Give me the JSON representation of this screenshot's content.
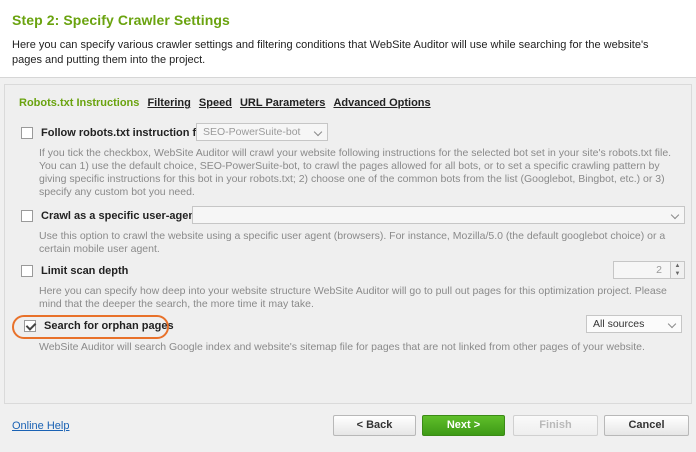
{
  "header": {
    "title": "Step 2: Specify Crawler Settings",
    "description": "Here you can specify various crawler settings and filtering conditions that WebSite Auditor will use while searching for the website's pages and putting them into the project."
  },
  "tabs": [
    {
      "label": "Robots.txt Instructions",
      "active": true
    },
    {
      "label": "Filtering",
      "active": false
    },
    {
      "label": "Speed",
      "active": false
    },
    {
      "label": "URL Parameters",
      "active": false
    },
    {
      "label": "Advanced Options",
      "active": false
    }
  ],
  "options": {
    "robots": {
      "label": "Follow robots.txt instruction for",
      "checked": false,
      "select_value": "SEO-PowerSuite-bot",
      "description": "If you tick the checkbox, WebSite Auditor will crawl your website following instructions for the selected bot set in your site's robots.txt file. You can 1) use the default choice, SEO-PowerSuite-bot, to crawl the pages allowed for all bots, or to set a specific crawling pattern by giving specific instructions for this bot in your robots.txt; 2) choose one of the common bots from the list (Googlebot, Bingbot, etc.) or 3) specify any custom bot you need."
    },
    "user_agent": {
      "label": "Crawl as a specific user-agent",
      "checked": false,
      "select_value": "",
      "description": "Use this option to crawl the website using a specific user agent (browsers). For instance, Mozilla/5.0 (the default googlebot choice) or a certain mobile user agent."
    },
    "scan_depth": {
      "label": "Limit scan depth",
      "checked": false,
      "value": "2",
      "description": "Here you can specify how deep into  your website structure WebSite Auditor will go to pull out pages for this optimization project. Please mind that the deeper the search, the more time it may take."
    },
    "orphan": {
      "label": "Search for orphan pages",
      "checked": true,
      "select_value": "All sources",
      "description": "WebSite Auditor will search Google index and website's sitemap file for pages that are not linked from other pages of your website."
    }
  },
  "footer": {
    "help_link": "Online Help",
    "back": "< Back",
    "next": "Next >",
    "finish": "Finish",
    "cancel": "Cancel"
  },
  "colors": {
    "accent_green": "#6aa30f",
    "primary_button": "#4caf1f",
    "highlight_orange": "#e8712a",
    "link_blue": "#1a62b4"
  }
}
